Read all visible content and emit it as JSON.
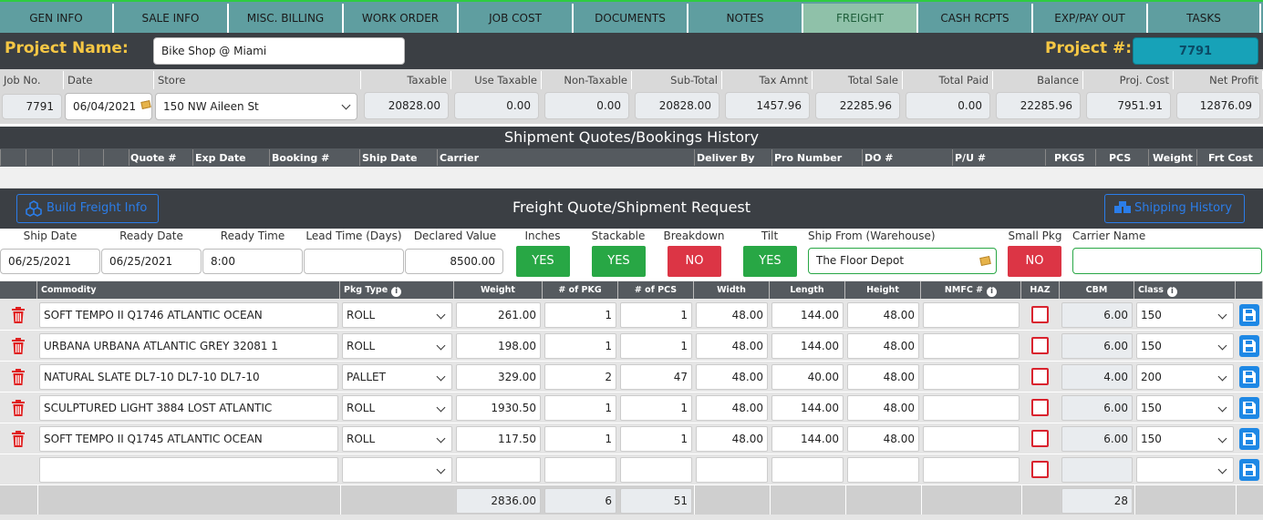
{
  "tabs": [
    "GEN INFO",
    "SALE INFO",
    "MISC. BILLING",
    "WORK ORDER",
    "JOB COST",
    "DOCUMENTS",
    "NOTES",
    "FREIGHT",
    "CASH RCPTS",
    "EXP/PAY OUT",
    "TASKS"
  ],
  "active_tab": "FREIGHT",
  "project": {
    "name_label": "Project Name:",
    "name": "Bike Shop @ Miami",
    "number_label": "Project #:",
    "number": "7791"
  },
  "summary": {
    "headers": [
      "Job No.",
      "Date",
      "Store",
      "Taxable",
      "Use Taxable",
      "Non-Taxable",
      "Sub-Total",
      "Tax Amnt",
      "Total Sale",
      "Total Paid",
      "Balance",
      "Proj. Cost",
      "Net Profit"
    ],
    "values": [
      "7791",
      "06/04/2021",
      "150 NW Aileen St",
      "20828.00",
      "0.00",
      "0.00",
      "20828.00",
      "1457.96",
      "22285.96",
      "0.00",
      "22285.96",
      "7951.91",
      "12876.09"
    ]
  },
  "history": {
    "title": "Shipment Quotes/Bookings History",
    "columns": [
      "Quote #",
      "Exp Date",
      "Booking #",
      "Ship Date",
      "Carrier",
      "Deliver By",
      "Pro Number",
      "DO #",
      "P/U #",
      "PKGS",
      "PCS",
      "Weight",
      "Frt Cost"
    ]
  },
  "freight": {
    "title": "Freight Quote/Shipment Request",
    "build_btn": "Build Freight Info",
    "history_btn": "Shipping History",
    "labels": [
      "Ship Date",
      "Ready Date",
      "Ready Time",
      "Lead Time (Days)",
      "Declared Value",
      "Inches",
      "Stackable",
      "Breakdown",
      "Tilt",
      "Ship From (Warehouse)",
      "Small Pkg",
      "Carrier Name"
    ],
    "ship_date": "06/25/2021",
    "ready_date": "06/25/2021",
    "ready_time": "8:00",
    "lead_time": "",
    "declared_value": "8500.00",
    "inches": "YES",
    "stackable": "YES",
    "breakdown": "NO",
    "tilt": "YES",
    "ship_from": "The Floor Depot",
    "small_pkg": "NO",
    "carrier": ""
  },
  "grid": {
    "headers": {
      "commodity": "Commodity",
      "pkg_type": "Pkg Type",
      "weight": "Weight",
      "pkg": "# of PKG",
      "pcs": "# of PCS",
      "width": "Width",
      "length": "Length",
      "height": "Height",
      "nmfc": "NMFC #",
      "haz": "HAZ",
      "cbm": "CBM",
      "class": "Class"
    },
    "rows": [
      {
        "commodity": "SOFT TEMPO II Q1746 ATLANTIC OCEAN",
        "pkg_type": "ROLL",
        "weight": "261.00",
        "pkg": "1",
        "pcs": "1",
        "width": "48.00",
        "length": "144.00",
        "height": "48.00",
        "nmfc": "",
        "cbm": "6.00",
        "class": "150"
      },
      {
        "commodity": "URBANA URBANA ATLANTIC GREY 32081 1",
        "pkg_type": "ROLL",
        "weight": "198.00",
        "pkg": "1",
        "pcs": "1",
        "width": "48.00",
        "length": "144.00",
        "height": "48.00",
        "nmfc": "",
        "cbm": "6.00",
        "class": "150"
      },
      {
        "commodity": "NATURAL SLATE DL7-10 DL7-10 DL7-10",
        "pkg_type": "PALLET",
        "weight": "329.00",
        "pkg": "2",
        "pcs": "47",
        "width": "48.00",
        "length": "40.00",
        "height": "48.00",
        "nmfc": "",
        "cbm": "4.00",
        "class": "200"
      },
      {
        "commodity": "SCULPTURED LIGHT 3884 LOST ATLANTIC",
        "pkg_type": "ROLL",
        "weight": "1930.50",
        "pkg": "1",
        "pcs": "1",
        "width": "48.00",
        "length": "144.00",
        "height": "48.00",
        "nmfc": "",
        "cbm": "6.00",
        "class": "150"
      },
      {
        "commodity": "SOFT TEMPO II Q1745 ATLANTIC OCEAN",
        "pkg_type": "ROLL",
        "weight": "117.50",
        "pkg": "1",
        "pcs": "1",
        "width": "48.00",
        "length": "144.00",
        "height": "48.00",
        "nmfc": "",
        "cbm": "6.00",
        "class": "150"
      }
    ],
    "totals": {
      "weight": "2836.00",
      "pkg": "6",
      "pcs": "51",
      "cbm": "28"
    }
  },
  "icons": {
    "delete": "trash-icon",
    "save": "floppy-disk-icon",
    "info": "info-circle-icon",
    "build": "cubes-icon",
    "history": "boxes-icon",
    "note": "note-icon"
  },
  "colors": {
    "tab_bg": "#5f9ea0",
    "active_tab": "#8fc1a9",
    "dark_bar": "#3b3f44",
    "yes": "#28a745",
    "no": "#dc3545",
    "accent": "#1e88e5",
    "label_yellow": "#f6c744"
  }
}
